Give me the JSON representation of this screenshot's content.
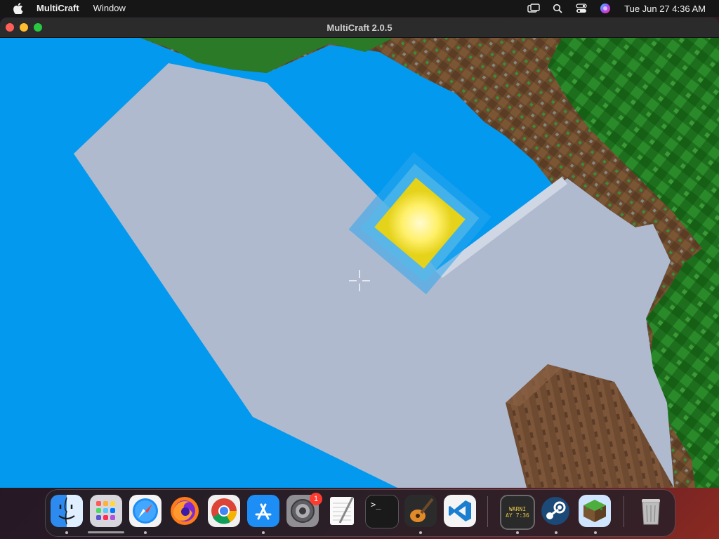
{
  "menubar": {
    "app_name": "MultiCraft",
    "menu_window": "Window",
    "clock": "Tue Jun 27  4:36 AM",
    "icons": [
      "screen-mirroring-icon",
      "search-icon",
      "control-center-icon",
      "siri-icon"
    ]
  },
  "window": {
    "title": "MultiCraft 2.0.5"
  },
  "game": {
    "sky_color": "#0399ef",
    "cloud_color": "#afbacf",
    "sun_color": "#fff27a",
    "leaves_color": "#1f7a1f",
    "dirt_color": "#6b4a2c",
    "wood_color": "#7a543a"
  },
  "dock": {
    "apps": [
      {
        "name": "Finder",
        "icon": "finder-icon"
      },
      {
        "name": "Launchpad",
        "icon": "launchpad-icon"
      },
      {
        "name": "Safari",
        "icon": "safari-icon"
      },
      {
        "name": "Firefox",
        "icon": "firefox-icon"
      },
      {
        "name": "Chrome",
        "icon": "chrome-icon"
      },
      {
        "name": "App Store",
        "icon": "app-store-icon"
      },
      {
        "name": "System Settings",
        "icon": "system-settings-icon"
      },
      {
        "name": "TextEdit",
        "icon": "textedit-icon"
      },
      {
        "name": "Terminal",
        "icon": "terminal-icon"
      },
      {
        "name": "GarageBand",
        "icon": "garageband-icon"
      },
      {
        "name": "Visual Studio Code",
        "icon": "vscode-icon"
      },
      {
        "name": "Console",
        "icon": "console-icon"
      },
      {
        "name": "Steam",
        "icon": "steam-icon"
      },
      {
        "name": "MultiCraft",
        "icon": "multicraft-icon"
      },
      {
        "name": "Trash",
        "icon": "trash-icon"
      }
    ],
    "settings_badge": "1",
    "terminal_prompt": ">_",
    "console_line1": "WARNI",
    "console_line2": "AY 7:36"
  }
}
